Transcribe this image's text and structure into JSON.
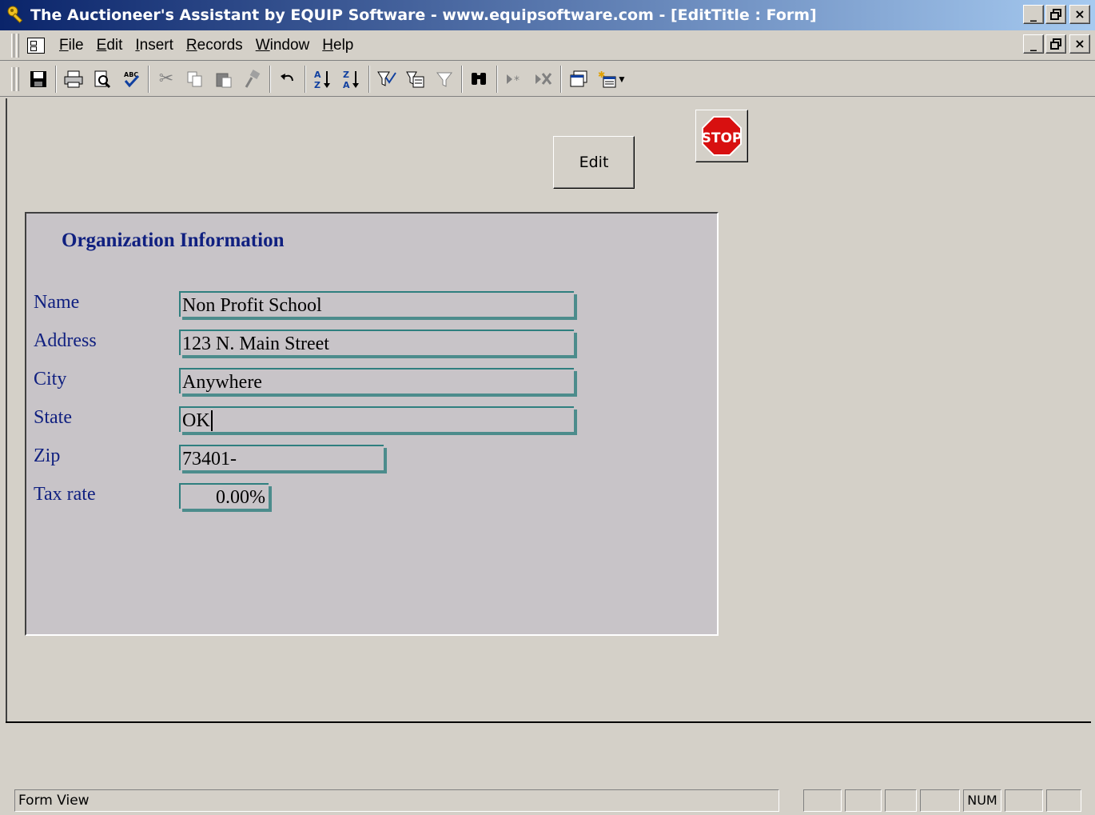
{
  "window": {
    "title": "The Auctioneer's Assistant by EQUIP Software - www.equipsoftware.com - [EditTitle : Form]",
    "buttons": {
      "minimize": "_",
      "restore": "🗗",
      "close": "×"
    }
  },
  "menu": {
    "items": [
      {
        "key": "F",
        "rest": "ile"
      },
      {
        "key": "E",
        "rest": "dit"
      },
      {
        "key": "I",
        "rest": "nsert"
      },
      {
        "key": "R",
        "rest": "ecords"
      },
      {
        "key": "W",
        "rest": "indow"
      },
      {
        "key": "H",
        "rest": "elp"
      }
    ]
  },
  "toolbar": {
    "icons": [
      "save-icon",
      "print-icon",
      "print-preview-icon",
      "spelling-icon",
      "cut-icon",
      "copy-icon",
      "paste-icon",
      "format-painter-icon",
      "undo-icon",
      "sort-ascending-icon",
      "sort-descending-icon",
      "filter-by-selection-icon",
      "filter-by-form-icon",
      "apply-filter-icon",
      "find-icon",
      "new-record-icon",
      "delete-record-icon",
      "database-window-icon",
      "new-object-icon"
    ]
  },
  "form": {
    "edit_button": "Edit",
    "stop_button": "STOP",
    "panel_title": "Organization Information",
    "fields": {
      "name": {
        "label": "Name",
        "value": "Non Profit School"
      },
      "address": {
        "label": "Address",
        "value": "123  N.  Main Street"
      },
      "city": {
        "label": "City",
        "value": "Anywhere"
      },
      "state": {
        "label": "State",
        "value": "OK"
      },
      "zip": {
        "label": "Zip",
        "value": "73401-"
      },
      "tax_rate": {
        "label": "Tax rate",
        "value": "0.00%"
      }
    }
  },
  "statusbar": {
    "text": "Form View",
    "num": "NUM"
  },
  "colors": {
    "title_gradient_start": "#0a246a",
    "title_gradient_end": "#a6caf0",
    "label_color": "#102080",
    "field_border": "#2f7f7f",
    "stop_red": "#d81010"
  }
}
